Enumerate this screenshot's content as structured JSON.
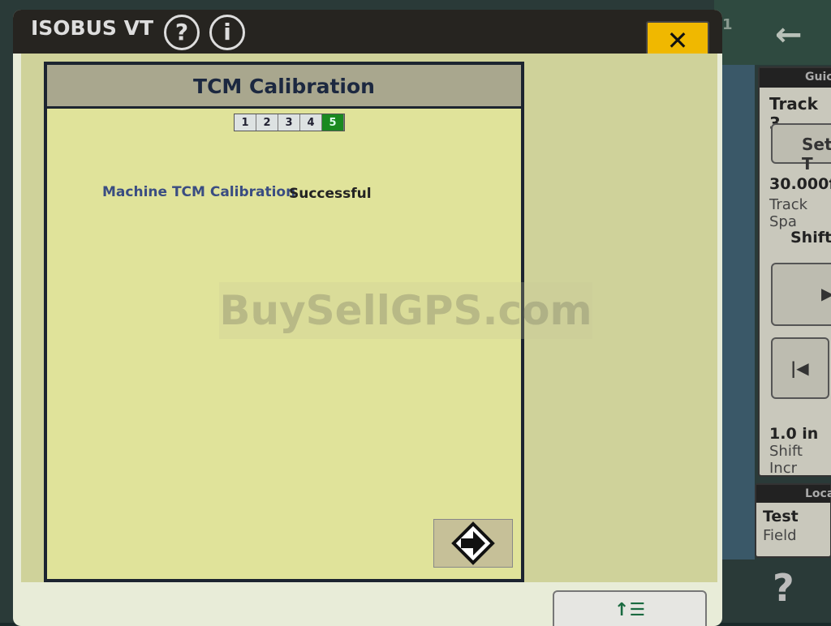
{
  "window": {
    "title": "ISOBUS VT",
    "help_icon": "?",
    "info_icon": "i",
    "close_label": "✕"
  },
  "mask": {
    "title": "TCM Calibration",
    "steps": [
      "1",
      "2",
      "3",
      "4",
      "5"
    ],
    "active_step": 5,
    "field_label": "Machine TCM Calibration",
    "field_value": "Successful",
    "next_icon": "arrow-right"
  },
  "watermark": "BuySellGPS.com",
  "bottom_button": "↑☰",
  "background": {
    "back_icon": "←",
    "corner_num": "1",
    "guidance_header": "Guic",
    "track": "Track 3",
    "set_button": "Set T",
    "spacing_value": "30.000f",
    "spacing_label": "Track Spa",
    "shift_label": "Shift",
    "shift_right": "▶",
    "shift_left": "|◀",
    "increment_value": "1.0 in",
    "increment_label": "Shift Incr",
    "location_header": "Loca",
    "location_value": "Test",
    "location_label": "Field",
    "help_icon": "?"
  }
}
